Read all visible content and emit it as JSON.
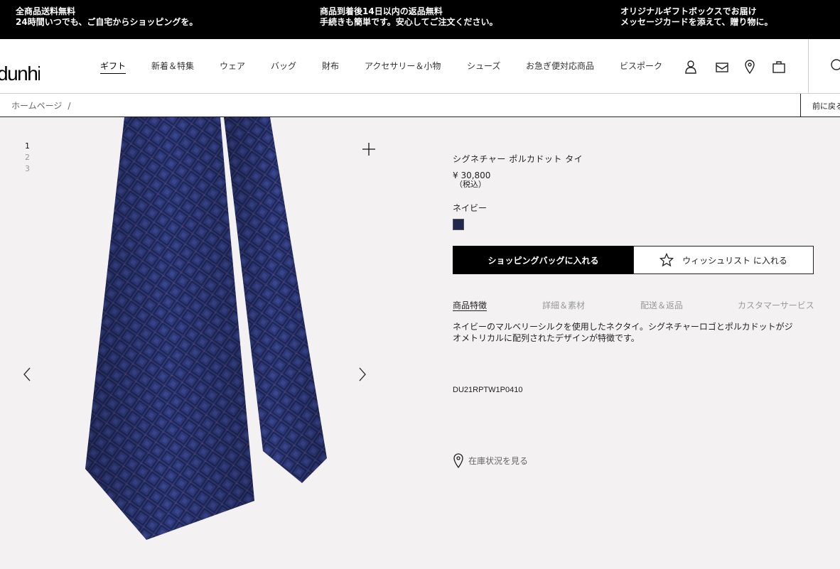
{
  "promo": {
    "left_line1": "全商品送料無料",
    "left_line2": "24時間いつでも、ご自宅からショッピングを。",
    "center_line1": "商品到着後14日以内の返品無料",
    "center_line2": "手続きも簡単です。安心してご注文ください。",
    "right_line1": "オリジナルギフトボックスでお届け",
    "right_line2": "メッセージカードを添えて、贈り物に。"
  },
  "brand": {
    "logo_text": "dunhill"
  },
  "nav": {
    "items": [
      {
        "label": "ギフト"
      },
      {
        "label": "新着＆特集"
      },
      {
        "label": "ウェア"
      },
      {
        "label": "バッグ"
      },
      {
        "label": "財布"
      },
      {
        "label": "アクセサリー＆小物"
      },
      {
        "label": "シューズ"
      },
      {
        "label": "お急ぎ便対応商品"
      },
      {
        "label": "ビスポーク"
      }
    ],
    "icons": [
      "account-icon",
      "mail-icon",
      "store-locator-icon",
      "shopping-bag-icon",
      "search-icon"
    ]
  },
  "breadcrumb": {
    "home": "ホームページ",
    "separator": "/",
    "back_label": "前に戻る"
  },
  "gallery": {
    "pages": [
      "1",
      "2",
      "3"
    ],
    "current_page": 1,
    "image_alt": "navy silk tie"
  },
  "product": {
    "title": "シグネチャー ポルカドット タイ",
    "price": "¥ 30,800",
    "tax_note": "（税込）",
    "color_name": "ネイビー",
    "color_hex": "#22284d",
    "add_to_bag": "ショッピングバッグに入れる",
    "add_to_wishlist": "ウィッシュリスト に入れる",
    "tabs": [
      {
        "label": "商品特徴",
        "active": true
      },
      {
        "label": "詳細＆素材",
        "active": false
      },
      {
        "label": "配送＆返品",
        "active": false
      },
      {
        "label": "カスタマーサービス",
        "active": false
      }
    ],
    "description": "ネイビーのマルベリーシルクを使用したネクタイ。シグネチャーロゴとポルカドットがジオメトリカルに配列されたデザインが特徴です。",
    "sku": "DU21RPTW1P0410",
    "stock_link": "在庫状況を見る"
  }
}
